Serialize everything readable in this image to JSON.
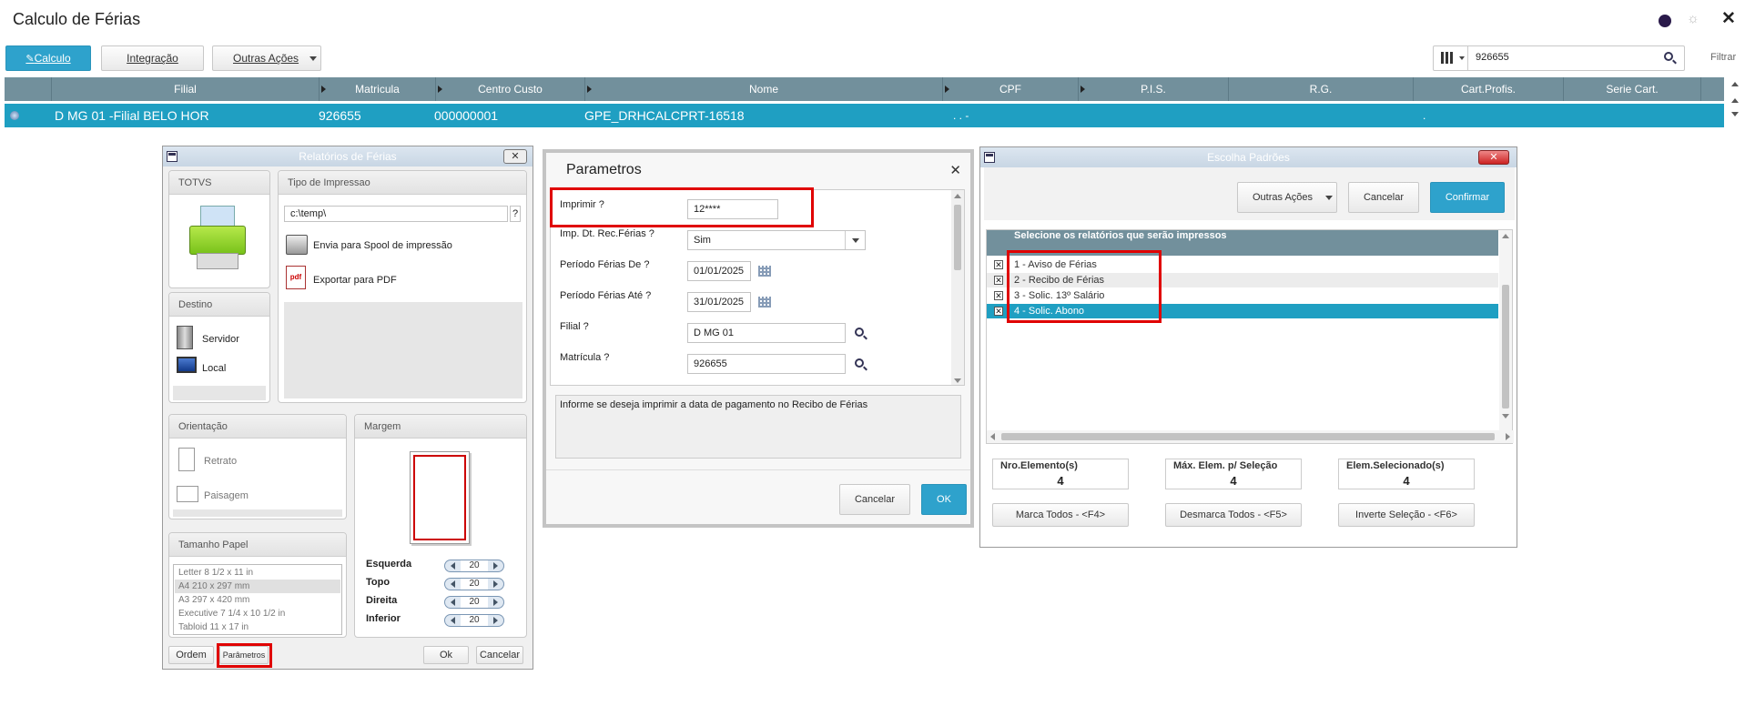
{
  "app": {
    "title": "Calculo de Férias",
    "filter_label": "Filtrar",
    "search_value": "926655"
  },
  "toolbar": {
    "calculo": "Calculo",
    "integracao": "Integração",
    "outras_acoes": "Outras Ações"
  },
  "grid": {
    "columns": [
      "Filial",
      "Matricula",
      "Centro Custo",
      "Nome",
      "CPF",
      "P.I.S.",
      "R.G.",
      "Cart.Profis.",
      "Serie Cart."
    ],
    "row": {
      "filial": "D MG 01 -Filial BELO HOR",
      "matricula": "926655",
      "centro_custo": "000000001",
      "nome": "GPE_DRHCALCPRT-16518",
      "cpf": ". . -",
      "cart": "."
    }
  },
  "relatorios": {
    "title": "Relatórios de Férias",
    "totvs": "TOTVS",
    "tipo_impressao": "Tipo de Impressao",
    "path": "c:\\temp\\",
    "help": "?",
    "spool": "Envia para Spool de impressão",
    "pdf": "Exportar para PDF",
    "destino": "Destino",
    "servidor": "Servidor",
    "local": "Local",
    "orientacao": "Orientação",
    "retrato": "Retrato",
    "paisagem": "Paisagem",
    "margem": "Margem",
    "tamanho_papel": "Tamanho Papel",
    "papers": [
      "Letter 8 1/2 x 11 in",
      "A4 210 x 297 mm",
      "A3 297 x 420 mm",
      "Executive 7 1/4 x 10 1/2 in",
      "Tabloid 11 x 17 in"
    ],
    "margins": [
      {
        "label": "Esquerda",
        "value": "20"
      },
      {
        "label": "Topo",
        "value": "20"
      },
      {
        "label": "Direita",
        "value": "20"
      },
      {
        "label": "Inferior",
        "value": "20"
      }
    ],
    "ordem": "Ordem",
    "parametros": "Parâmetros",
    "ok": "Ok",
    "cancelar": "Cancelar"
  },
  "parametros": {
    "title": "Parametros",
    "fields": [
      {
        "label": "Imprimir ?",
        "value": "12****"
      },
      {
        "label": "Imp. Dt. Rec.Férias ?",
        "value": "Sim"
      },
      {
        "label": "Período Férias De ?",
        "value": "01/01/2025"
      },
      {
        "label": "Período Férias Até ?",
        "value": "31/01/2025"
      },
      {
        "label": "Filial ?",
        "value": "D MG 01"
      },
      {
        "label": "Matrícula ?",
        "value": "926655"
      }
    ],
    "help_text": "Informe se deseja imprimir a data de pagamento no Recibo de Férias",
    "cancel": "Cancelar",
    "ok": "OK"
  },
  "escolha": {
    "title": "Escolha Padrões",
    "outras_acoes": "Outras Ações",
    "cancelar": "Cancelar",
    "confirmar": "Confirmar",
    "list_header": "Selecione os relatórios que serão impressos",
    "items": [
      "1 - Aviso de Férias",
      "2 - Recibo de Férias",
      "3 - Solic. 13º Salário",
      "4 - Solic. Abono"
    ],
    "check_mark": "✕",
    "stats": [
      {
        "label": "Nro.Elemento(s)",
        "value": "4"
      },
      {
        "label": "Máx. Elem. p/ Seleção",
        "value": "4"
      },
      {
        "label": "Elem.Selecionado(s)",
        "value": "4"
      }
    ],
    "marca": "Marca Todos - <F4>",
    "desmarca": "Desmarca Todos - <F5>",
    "inverte": "Inverte Seleção - <F6>"
  },
  "colors": {
    "accent": "#2ea2cc",
    "header_bg": "#72909c",
    "highlight": "#e00000"
  }
}
